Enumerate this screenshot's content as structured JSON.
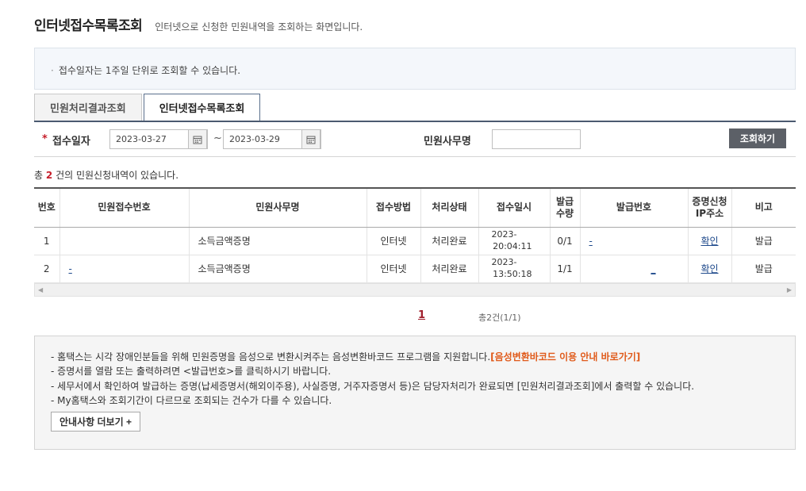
{
  "header": {
    "title": "인터넷접수목록조회",
    "description": "인터넷으로 신청한 민원내역을 조회하는 화면입니다."
  },
  "notice": {
    "text": "접수일자는 1주일 단위로 조회할 수 있습니다."
  },
  "tabs": [
    {
      "label": "민원처리결과조회",
      "active": false
    },
    {
      "label": "인터넷접수목록조회",
      "active": true
    }
  ],
  "search": {
    "date_label": "접수일자",
    "date_from": "2023-03-27",
    "date_to": "2023-03-29",
    "tilde": "~",
    "affair_label": "민원사무명",
    "affair_value": "",
    "button": "조회하기"
  },
  "result": {
    "prefix": "총",
    "count": "2",
    "suffix": "건의 민원신청내역이 있습니다."
  },
  "table": {
    "headers": [
      "번호",
      "민원접수번호",
      "민원사무명",
      "접수방법",
      "처리상태",
      "접수일시",
      "발급\n수량",
      "발급번호",
      "증명신청\nIP주소",
      "비고"
    ],
    "rows": [
      {
        "no": "1",
        "receipt_no": "",
        "affair": "소득금액증명",
        "method": "인터넷",
        "status": "처리완료",
        "date_line1": "2023-",
        "date_line2": "20:04:11",
        "qty": "0/1",
        "issue_no": "-",
        "ip": "확인",
        "note": "발급"
      },
      {
        "no": "2",
        "receipt_no": "-",
        "affair": "소득금액증명",
        "method": "인터넷",
        "status": "처리완료",
        "date_line1": "2023-",
        "date_line2": "13:50:18",
        "qty": "1/1",
        "issue_no": "_",
        "ip": "확인",
        "note": "발급"
      }
    ]
  },
  "pagination": {
    "current": "1",
    "total": "총2건(1/1)"
  },
  "info": {
    "items": [
      "홈택스는 시각 장애인분들을 위해 민원증명을 음성으로 변환시켜주는 음성변환바코드 프로그램을 지원합니다.",
      "증명서를 열람 또는 출력하려면 <발급번호>를 클릭하시기 바랍니다.",
      "세무서에서 확인하여 발급하는 증명(납세증명서(해외이주용), 사실증명, 거주자증명서 등)은 담당자처리가 완료되면 [민원처리결과조회]에서 출력할 수 있습니다.",
      "My홈택스와 조회기간이 다르므로 조회되는 건수가 다를 수 있습니다."
    ],
    "barcode_link": "[음성변환바코드 이용 안내 바로가기]",
    "more_button": "안내사항 더보기 +"
  }
}
